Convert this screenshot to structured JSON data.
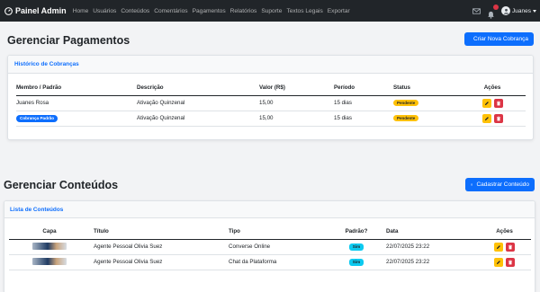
{
  "navbar": {
    "brand": "Painel Admin",
    "links": [
      "Home",
      "Usuários",
      "Conteúdos",
      "Comentários",
      "Pagamentos",
      "Relatórios",
      "Suporte",
      "Textos Legais",
      "Exportar"
    ],
    "user": "Juanes"
  },
  "payments": {
    "title": "Gerenciar Pagamentos",
    "create_button": "Criar Nova Cobrança",
    "card_title": "Histórico de Cobranças",
    "columns": [
      "Membro / Padrão",
      "Descrição",
      "Valor (R$)",
      "Período",
      "Status",
      "Ações"
    ],
    "rows": [
      {
        "member": "Juanes Rosa",
        "member_is_badge": false,
        "description": "Ativação Quinzenal",
        "value": "15,00",
        "period": "15 dias",
        "status": "Pendente"
      },
      {
        "member": "Cobrança Padrão",
        "member_is_badge": true,
        "description": "Ativação Quinzenal",
        "value": "15,00",
        "period": "15 dias",
        "status": "Pendente"
      }
    ]
  },
  "contents": {
    "title": "Gerenciar Conteúdos",
    "create_button": "Cadastrar Conteúdo",
    "card_title": "Lista de Conteúdos",
    "columns": [
      "Capa",
      "Título",
      "Tipo",
      "Padrão?",
      "Data",
      "Ações"
    ],
    "rows": [
      {
        "title": "Agente Pessoal Olivia Suez",
        "type": "Converse Online",
        "default": "Sim",
        "date": "22/07/2025 23:22"
      },
      {
        "title": "Agente Pessoal Olivia Suez",
        "type": "Chat da Plataforma",
        "default": "Sim",
        "date": "22/07/2025 23:22"
      }
    ]
  },
  "colors": {
    "primary": "#0d6efd",
    "warning": "#ffc107",
    "danger": "#dc3545",
    "info": "#0dcaf0",
    "navbar": "#212529"
  }
}
